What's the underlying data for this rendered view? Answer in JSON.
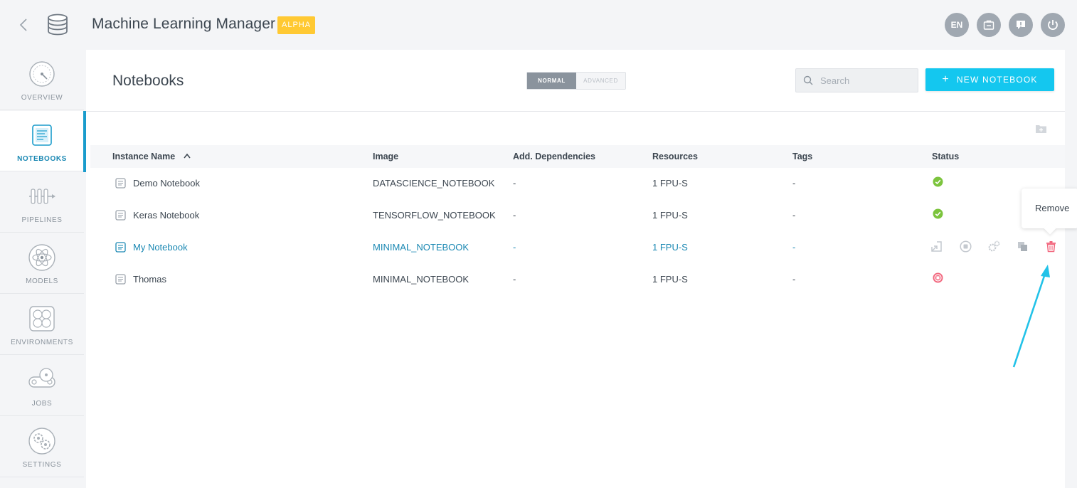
{
  "app": {
    "title": "Machine Learning Manager",
    "badge": "ALPHA",
    "lang": "EN",
    "accent": "#14c7ef",
    "badge_color": "#ffc933"
  },
  "sidebar": {
    "items": [
      {
        "label": "OVERVIEW",
        "icon": "gauge-icon"
      },
      {
        "label": "NOTEBOOKS",
        "icon": "notebook-icon",
        "active": true
      },
      {
        "label": "PIPELINES",
        "icon": "pipeline-icon"
      },
      {
        "label": "MODELS",
        "icon": "atom-icon"
      },
      {
        "label": "ENVIRONMENTS",
        "icon": "environment-icon"
      },
      {
        "label": "JOBS",
        "icon": "conveyor-icon"
      },
      {
        "label": "SETTINGS",
        "icon": "gear-icon"
      }
    ]
  },
  "main": {
    "title": "Notebooks",
    "mode": {
      "normal": "NORMAL",
      "advanced": "ADVANCED",
      "selected": "normal"
    },
    "search": {
      "placeholder": "Search",
      "value": ""
    },
    "new_button": {
      "plus": "+",
      "label": "NEW NOTEBOOK"
    }
  },
  "table": {
    "columns": [
      "Instance Name",
      "Image",
      "Add. Dependencies",
      "Resources",
      "Tags",
      "Status"
    ],
    "sorted_column": "Instance Name",
    "rows": [
      {
        "name": "Demo Notebook",
        "image": "DATASCIENCE_NOTEBOOK",
        "deps": "-",
        "resources": "1 FPU-S",
        "tags": "-",
        "status": "running"
      },
      {
        "name": "Keras Notebook",
        "image": "TENSORFLOW_NOTEBOOK",
        "deps": "-",
        "resources": "1 FPU-S",
        "tags": "-",
        "status": "running"
      },
      {
        "name": "My Notebook",
        "image": "MINIMAL_NOTEBOOK",
        "deps": "-",
        "resources": "1 FPU-S",
        "tags": "-",
        "status": "hover"
      },
      {
        "name": "Thomas",
        "image": "MINIMAL_NOTEBOOK",
        "deps": "-",
        "resources": "1 FPU-S",
        "tags": "-",
        "status": "stopped"
      }
    ],
    "row_actions": [
      "open-icon",
      "stop-icon",
      "settings-icon",
      "duplicate-icon",
      "trash-icon"
    ]
  },
  "tooltip": {
    "text": "Remove"
  },
  "colors": {
    "running": "#7cc43d",
    "stopped": "#f2677e",
    "link": "#1a88b3",
    "danger": "#f2677e"
  }
}
